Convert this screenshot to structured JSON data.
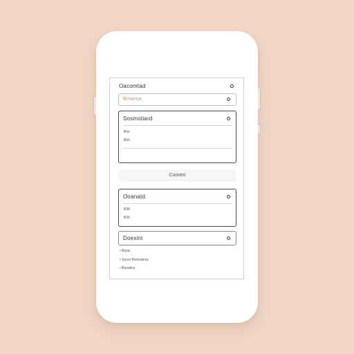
{
  "header": {
    "title": "Oacomtad"
  },
  "select_field": {
    "value": "Binanoe"
  },
  "section1": {
    "title": "Sosmotiard",
    "items": [
      "Bhs",
      "Bh5"
    ]
  },
  "action_button": {
    "label": "Cuoveo"
  },
  "section2": {
    "title": "Ooanatd",
    "items": [
      "B38",
      "B35"
    ]
  },
  "dropdown": {
    "title": "Doexint",
    "options": [
      "• Biyas",
      "• Soner Bertoatnos",
      "• Bunalins"
    ]
  },
  "colors": {
    "accent": "#c98a5a",
    "background": "#f2d7c6"
  }
}
